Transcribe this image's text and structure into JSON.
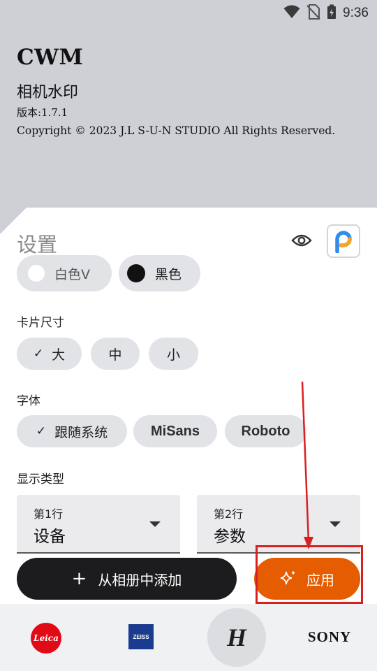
{
  "status_bar": {
    "time": "9:36"
  },
  "header": {
    "app_name": "CWM",
    "app_subtitle": "相机水印",
    "version": "版本:1.7.1",
    "copyright": "Copyright © 2023 J.L S-U-N STUDIO All Rights Reserved."
  },
  "settings": {
    "title": "设置",
    "color_chips": [
      {
        "label": "白色V",
        "selected": false
      },
      {
        "label": "黑色",
        "selected": false
      }
    ],
    "card_size": {
      "label": "卡片尺寸",
      "options": [
        {
          "label": "大",
          "selected": true
        },
        {
          "label": "中",
          "selected": false
        },
        {
          "label": "小",
          "selected": false
        }
      ]
    },
    "font": {
      "label": "字体",
      "options": [
        {
          "label": "跟随系统",
          "selected": true
        },
        {
          "label": "MiSans",
          "selected": false
        },
        {
          "label": "Roboto",
          "selected": false
        }
      ]
    },
    "display_type": {
      "label": "显示类型",
      "row1": {
        "label": "第1行",
        "value": "设备"
      },
      "row2": {
        "label": "第2行",
        "value": "参数"
      }
    }
  },
  "actions": {
    "add_from_album": "从相册中添加",
    "apply": "应用"
  },
  "brands": {
    "leica": "Leica",
    "zeiss": "ZEISS",
    "hasselblad": "H",
    "sony": "SONY"
  },
  "colors": {
    "header_bg": "#ced0d5",
    "accent_orange": "#e65c00",
    "dark_button": "#1c1c1e",
    "chip_bg": "#e2e3e7",
    "annotation_red": "#d92020"
  }
}
